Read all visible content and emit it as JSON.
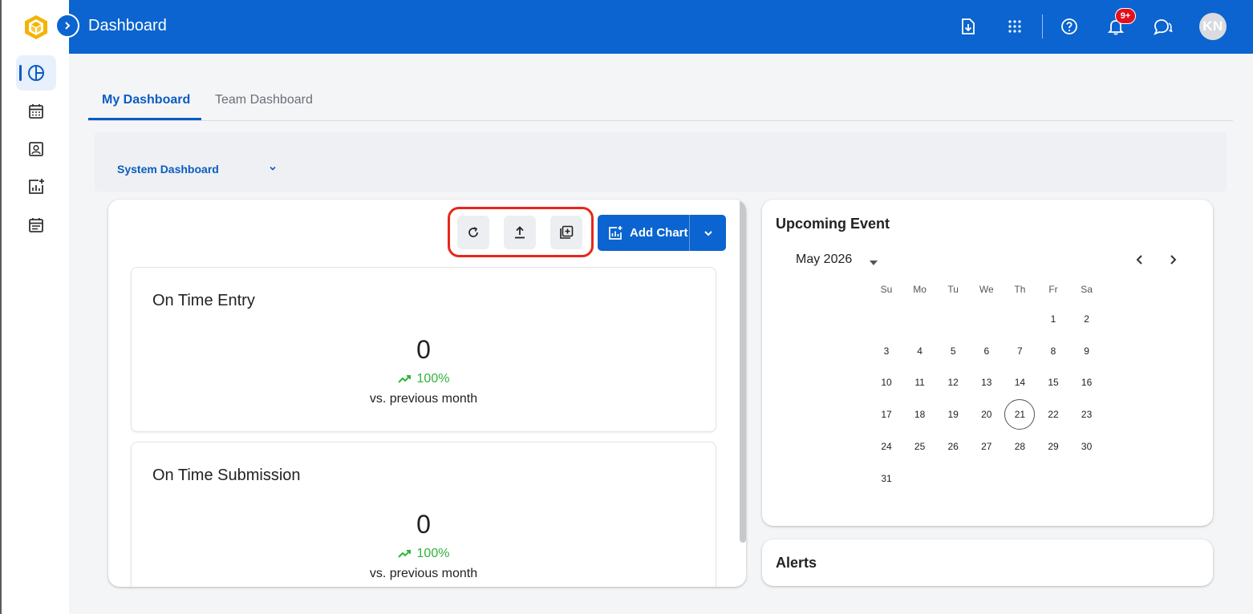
{
  "header": {
    "title": "Dashboard",
    "notification_badge": "9+",
    "avatar_initials": "KN"
  },
  "tabs": [
    {
      "label": "My Dashboard"
    },
    {
      "label": "Team Dashboard"
    }
  ],
  "dashboard_selector": {
    "selected": "System Dashboard"
  },
  "toolbar": {
    "add_chart_label": "Add Chart"
  },
  "cards": [
    {
      "title": "On Time Entry",
      "value": "0",
      "trend": "100%",
      "comparison": "vs. previous month"
    },
    {
      "title": "On Time Submission",
      "value": "0",
      "trend": "100%",
      "comparison": "vs. previous month"
    }
  ],
  "upcoming_event": {
    "title": "Upcoming Event",
    "month_label": "May 2026",
    "weekday_headers": [
      "Su",
      "Mo",
      "Tu",
      "We",
      "Th",
      "Fr",
      "Sa"
    ],
    "days": [
      "1",
      "2",
      "3",
      "4",
      "5",
      "6",
      "7",
      "8",
      "9",
      "10",
      "11",
      "12",
      "13",
      "14",
      "15",
      "16",
      "17",
      "18",
      "19",
      "20",
      "21",
      "22",
      "23",
      "24",
      "25",
      "26",
      "27",
      "28",
      "29",
      "30",
      "31"
    ],
    "first_weekday_index": 5,
    "today": "21"
  },
  "alerts": {
    "title": "Alerts"
  },
  "colors": {
    "brand": "#0b64cf",
    "trend_up": "#2fb53a",
    "highlight": "#e8261a",
    "badge": "#e3101e"
  }
}
